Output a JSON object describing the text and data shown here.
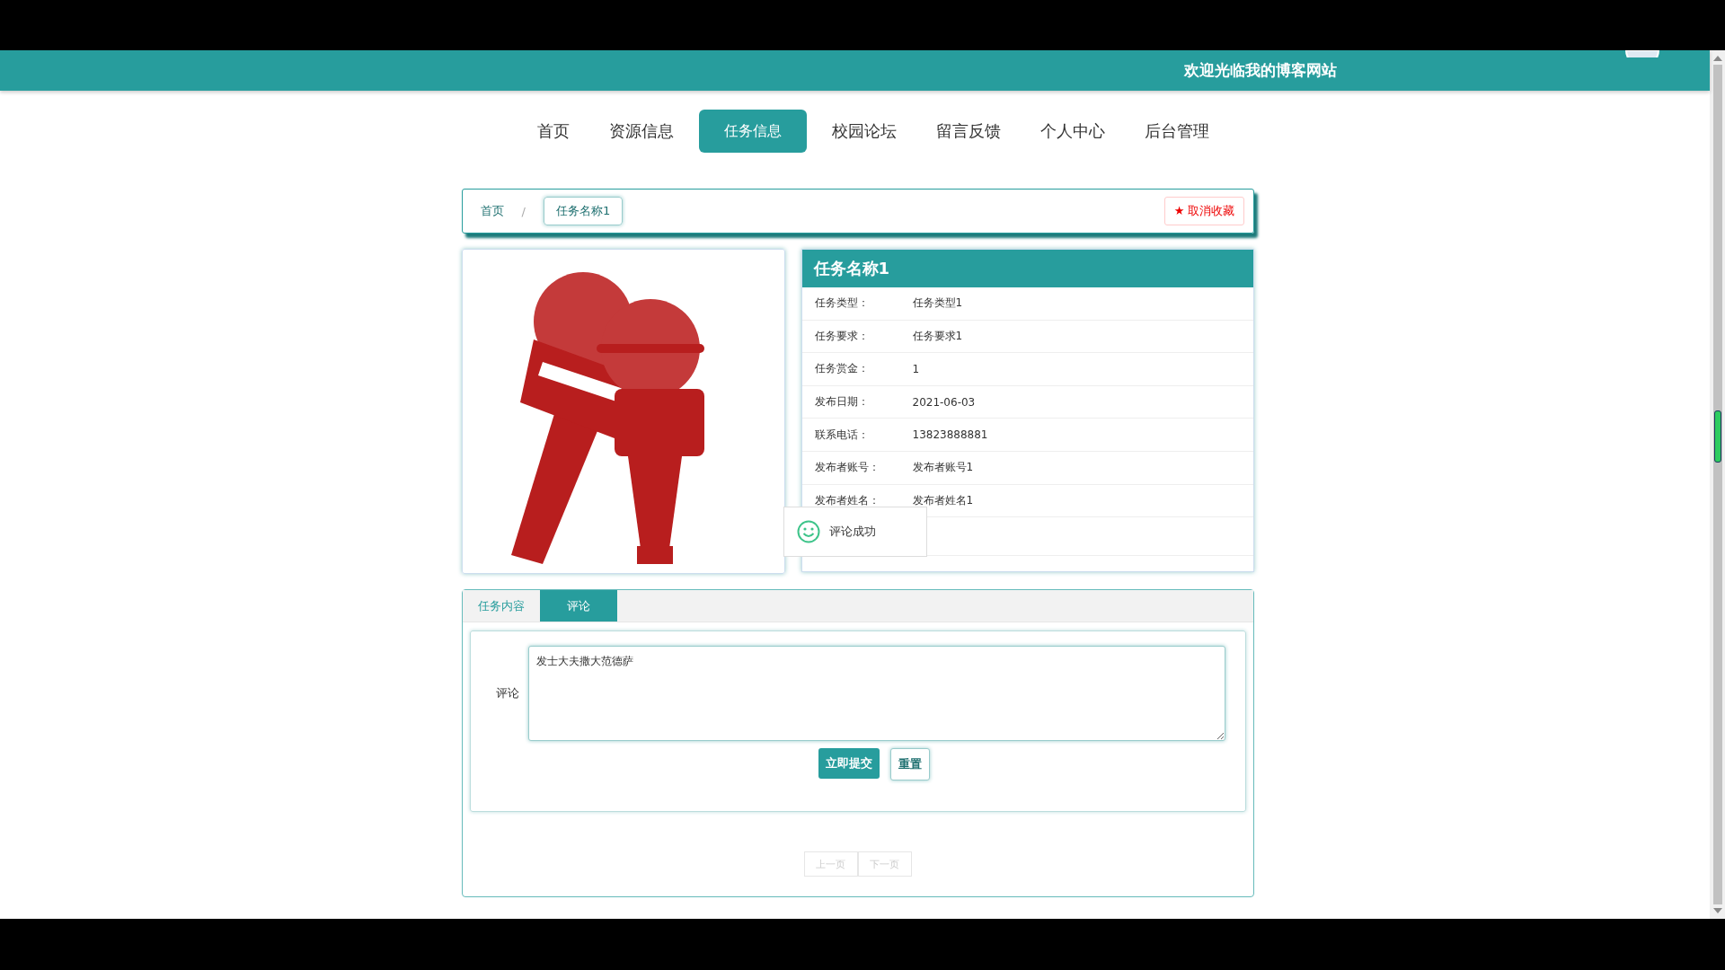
{
  "header": {
    "welcome": "欢迎光临我的博客网站"
  },
  "nav": [
    {
      "label": "首页",
      "selected": false
    },
    {
      "label": "资源信息",
      "selected": false
    },
    {
      "label": "任务信息",
      "selected": true
    },
    {
      "label": "校园论坛",
      "selected": false
    },
    {
      "label": "留言反馈",
      "selected": false
    },
    {
      "label": "个人中心",
      "selected": false
    },
    {
      "label": "后台管理",
      "selected": false
    }
  ],
  "breadcrumb": {
    "items": [
      {
        "label": "首页",
        "kind": "link"
      },
      {
        "label": "任务名称1",
        "kind": "current"
      }
    ],
    "separator": "/",
    "favorite_button": {
      "icon": "★",
      "label": "取消收藏"
    }
  },
  "detail": {
    "title": "任务名称1",
    "rows": [
      {
        "label": "任务类型：",
        "value": "任务类型1"
      },
      {
        "label": "任务要求：",
        "value": "任务要求1"
      },
      {
        "label": "任务赏金：",
        "value": "1"
      },
      {
        "label": "发布日期：",
        "value": "2021-06-03"
      },
      {
        "label": "联系电话：",
        "value": "13823888881"
      },
      {
        "label": "发布者账号：",
        "value": "发布者账号1"
      },
      {
        "label": "发布者姓名：",
        "value": "发布者姓名1"
      }
    ]
  },
  "toast": {
    "message": "评论成功"
  },
  "tabs": [
    {
      "label": "任务内容",
      "selected": false
    },
    {
      "label": "评论",
      "selected": true
    }
  ],
  "comment_form": {
    "label": "评论",
    "value": "发士大夫撒大范德萨",
    "submit": "立即提交",
    "reset": "重置"
  },
  "pagination": {
    "prev": "上一页",
    "next": "下一页",
    "disabled": true
  }
}
